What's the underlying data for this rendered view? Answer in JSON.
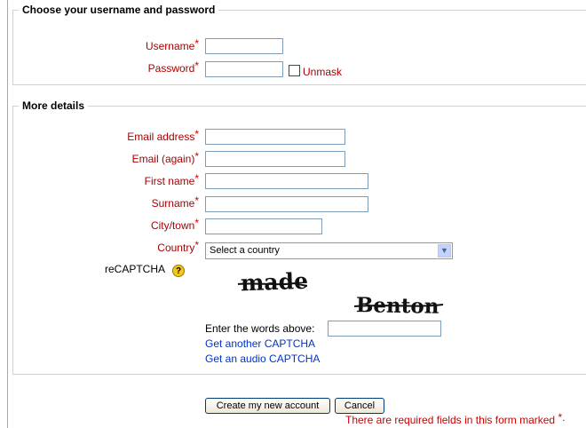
{
  "section1": {
    "legend": "Choose your username and password",
    "username_label": "Username",
    "password_label": "Password",
    "unmask_label": "Unmask",
    "required_mark": "*"
  },
  "section2": {
    "legend": "More details",
    "email_label": "Email address",
    "email_again_label": "Email (again)",
    "firstname_label": "First name",
    "surname_label": "Surname",
    "city_label": "City/town",
    "country_label": "Country",
    "country_selected": "Select a country",
    "recaptcha_label": "reCAPTCHA",
    "captcha_word1": "made",
    "captcha_word2": "Benton",
    "enter_words_label": "Enter the words above:",
    "get_another": "Get another CAPTCHA",
    "get_audio": "Get an audio CAPTCHA"
  },
  "buttons": {
    "create": "Create my new account",
    "cancel": "Cancel"
  },
  "required_note": "There are required fields in this form marked",
  "required_note_mark": "*."
}
